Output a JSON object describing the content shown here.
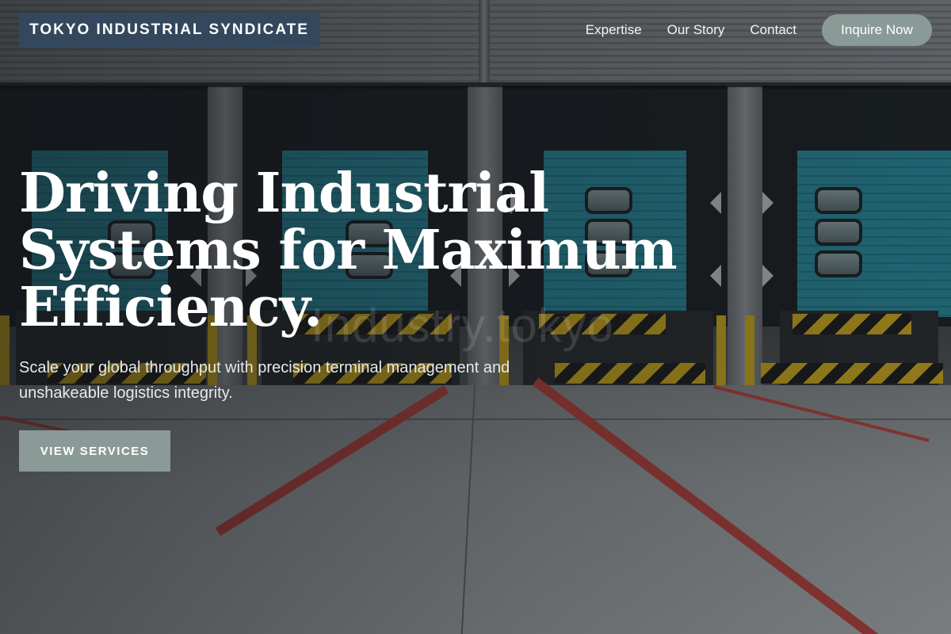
{
  "header": {
    "brand": "TOKYO INDUSTRIAL SYNDICATE",
    "nav": [
      {
        "label": "Expertise"
      },
      {
        "label": "Our Story"
      },
      {
        "label": "Contact"
      }
    ],
    "cta_label": "Inquire Now"
  },
  "hero": {
    "title": "Driving Industrial Systems for Maximum Efficiency.",
    "subtitle": "Scale your global throughput with precision terminal management and unshakeable logistics integrity.",
    "button_label": "VIEW SERVICES",
    "watermark": "Industry.tokyo"
  },
  "colors": {
    "brand_bg": "#34475c",
    "accent_button": "#8a9a97",
    "overlay": "#0f1216"
  }
}
